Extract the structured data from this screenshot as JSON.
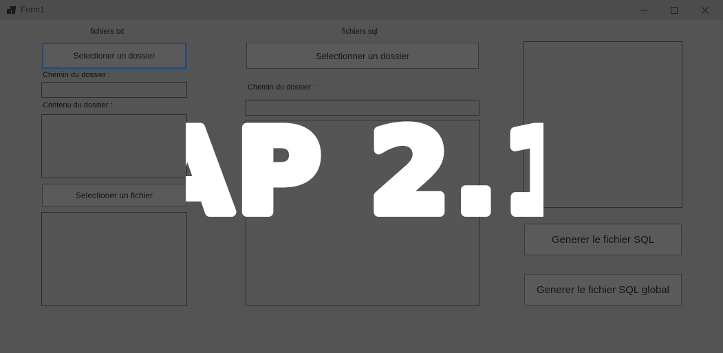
{
  "window": {
    "title": "Form1",
    "minimize_icon": "minimize-icon",
    "maximize_icon": "maximize-icon",
    "close_icon": "close-icon"
  },
  "left_panel": {
    "header": "fichiers txt",
    "select_folder_button": "Selectioner un dossier",
    "folder_path_label": "Chemin du dossier :",
    "folder_path_value": "",
    "folder_content_label": "Contenu du dossier :",
    "select_file_button": "Selectioner un fichier"
  },
  "middle_panel": {
    "header": "fichiers sql",
    "select_folder_button": "Selectionner un dossier",
    "folder_path_label": "Chemin du dossier :",
    "folder_path_value": ""
  },
  "right_panel": {
    "generate_sql_button": "Generer le fichier SQL",
    "generate_global_sql_button": "Generer le fichier SQL global"
  },
  "overlay": {
    "text": "AP 2.1"
  }
}
